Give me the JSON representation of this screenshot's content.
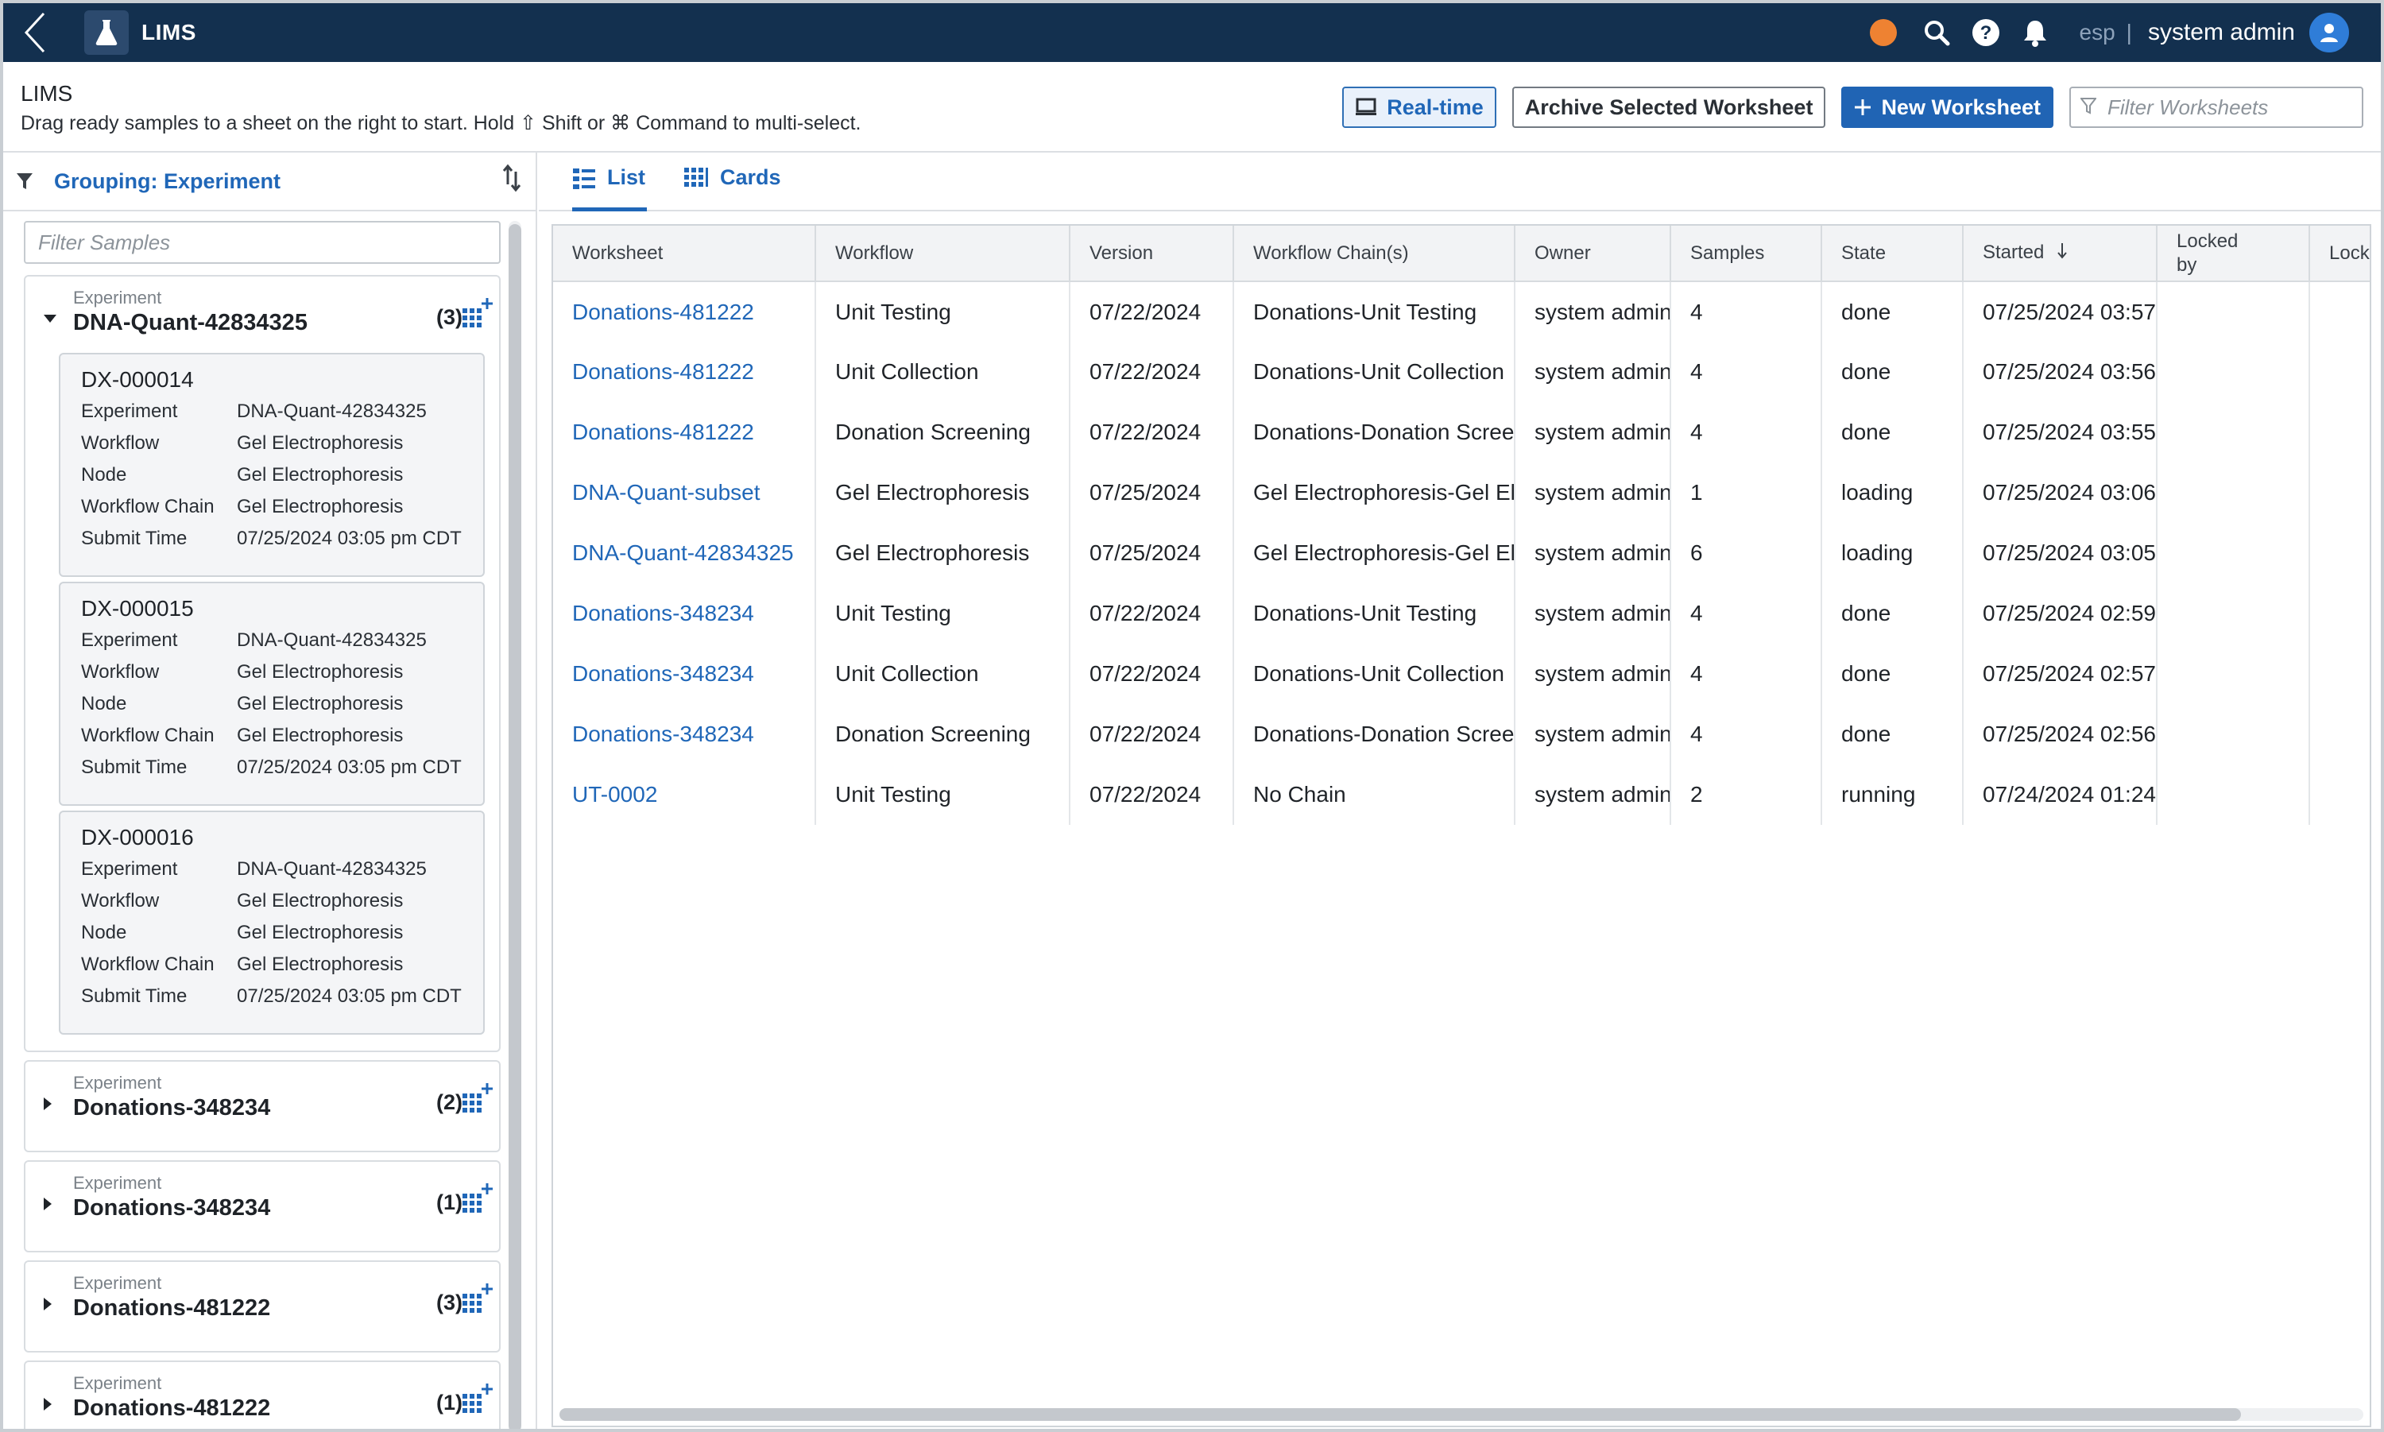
{
  "app": {
    "name": "LIMS",
    "tenant": "esp",
    "tenant_separator": "|",
    "user": "system admin",
    "status_color": "#ee8232",
    "icons": [
      "back-chevron-icon",
      "flask-icon",
      "search-icon",
      "help-icon",
      "bell-icon",
      "user-avatar-icon"
    ]
  },
  "page": {
    "title": "LIMS",
    "subtitle": "Drag ready samples to a sheet on the right to start. Hold ⇧ Shift or ⌘ Command to multi-select."
  },
  "actions": {
    "realtime_label": "Real-time",
    "archive_label": "Archive Selected Worksheet",
    "new_label": "New Worksheet",
    "filter_placeholder": "Filter Worksheets"
  },
  "sidebar": {
    "grouping_label": "Grouping: Experiment",
    "filter_placeholder": "Filter Samples",
    "kicker": "Experiment",
    "field_labels": {
      "experiment": "Experiment",
      "workflow": "Workflow",
      "node": "Node",
      "workflow_chain": "Workflow Chain",
      "submit_time": "Submit Time"
    },
    "groups": [
      {
        "title": "DNA-Quant-42834325",
        "count": "(3)",
        "expanded": true,
        "samples": [
          {
            "id": "DX-000014",
            "experiment": "DNA-Quant-42834325",
            "workflow": "Gel Electrophoresis",
            "node": "Gel Electrophoresis",
            "workflow_chain": "Gel Electrophoresis",
            "submit_time": "07/25/2024 03:05 pm CDT"
          },
          {
            "id": "DX-000015",
            "experiment": "DNA-Quant-42834325",
            "workflow": "Gel Electrophoresis",
            "node": "Gel Electrophoresis",
            "workflow_chain": "Gel Electrophoresis",
            "submit_time": "07/25/2024 03:05 pm CDT"
          },
          {
            "id": "DX-000016",
            "experiment": "DNA-Quant-42834325",
            "workflow": "Gel Electrophoresis",
            "node": "Gel Electrophoresis",
            "workflow_chain": "Gel Electrophoresis",
            "submit_time": "07/25/2024 03:05 pm CDT"
          }
        ]
      },
      {
        "title": "Donations-348234",
        "count": "(2)",
        "expanded": false
      },
      {
        "title": "Donations-348234",
        "count": "(1)",
        "expanded": false
      },
      {
        "title": "Donations-481222",
        "count": "(3)",
        "expanded": false
      },
      {
        "title": "Donations-481222",
        "count": "(1)",
        "expanded": false
      }
    ]
  },
  "tabs": [
    {
      "label": "List",
      "icon": "list-icon",
      "active": true
    },
    {
      "label": "Cards",
      "icon": "cards-grid-icon",
      "active": false
    }
  ],
  "table": {
    "columns": [
      "Worksheet",
      "Workflow",
      "Version",
      "Workflow Chain(s)",
      "Owner",
      "Samples",
      "State",
      "Started",
      "Locked by",
      "Lock"
    ],
    "sorted_column": "Started",
    "sort_direction": "descending",
    "rows": [
      [
        "Donations-481222",
        "Unit Testing",
        "07/22/2024",
        "Donations-Unit Testing",
        "system admin",
        "4",
        "done",
        "07/25/2024 03:57",
        "",
        ""
      ],
      [
        "Donations-481222",
        "Unit Collection",
        "07/22/2024",
        "Donations-Unit Collection",
        "system admin",
        "4",
        "done",
        "07/25/2024 03:56",
        "",
        ""
      ],
      [
        "Donations-481222",
        "Donation Screening",
        "07/22/2024",
        "Donations-Donation Screening",
        "system admin",
        "4",
        "done",
        "07/25/2024 03:55",
        "",
        ""
      ],
      [
        "DNA-Quant-subset",
        "Gel Electrophoresis",
        "07/25/2024",
        "Gel Electrophoresis-Gel Electrophoresis",
        "system admin",
        "1",
        "loading",
        "07/25/2024 03:06",
        "",
        ""
      ],
      [
        "DNA-Quant-42834325",
        "Gel Electrophoresis",
        "07/25/2024",
        "Gel Electrophoresis-Gel Electrophoresis",
        "system admin",
        "6",
        "loading",
        "07/25/2024 03:05",
        "",
        ""
      ],
      [
        "Donations-348234",
        "Unit Testing",
        "07/22/2024",
        "Donations-Unit Testing",
        "system admin",
        "4",
        "done",
        "07/25/2024 02:59",
        "",
        ""
      ],
      [
        "Donations-348234",
        "Unit Collection",
        "07/22/2024",
        "Donations-Unit Collection",
        "system admin",
        "4",
        "done",
        "07/25/2024 02:57",
        "",
        ""
      ],
      [
        "Donations-348234",
        "Donation Screening",
        "07/22/2024",
        "Donations-Donation Screening",
        "system admin",
        "4",
        "done",
        "07/25/2024 02:56",
        "",
        ""
      ],
      [
        "UT-0002",
        "Unit Testing",
        "07/22/2024",
        "No Chain",
        "system admin",
        "2",
        "running",
        "07/24/2024 01:24",
        "",
        ""
      ]
    ]
  },
  "colors": {
    "nav": "#13304f",
    "accent": "#2067b8",
    "primary_button": "#2064b4"
  }
}
